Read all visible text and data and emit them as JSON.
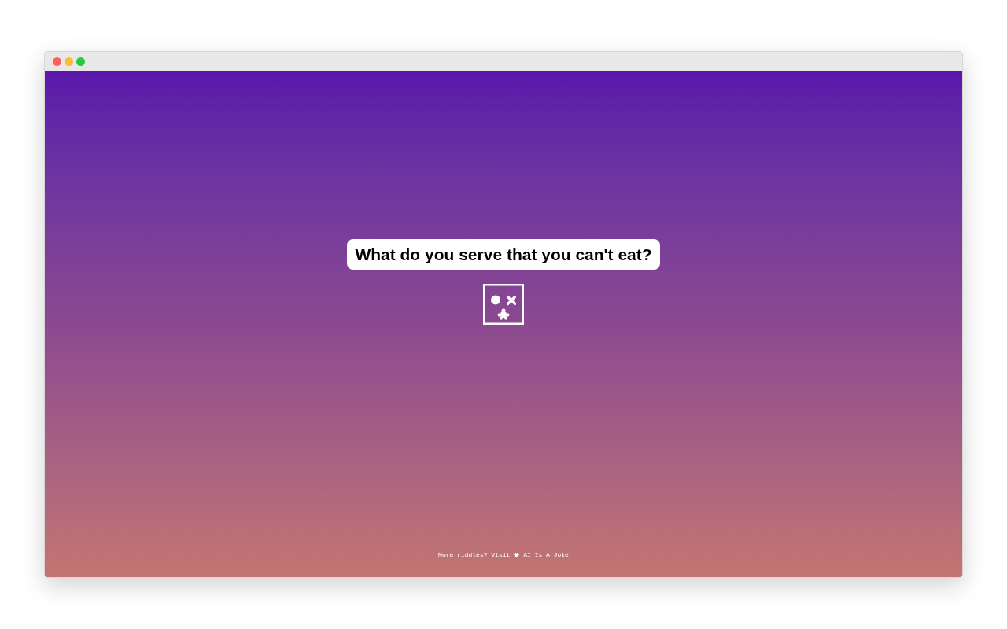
{
  "window": {
    "controls": [
      {
        "color": "#ff5f57"
      },
      {
        "color": "#febc2e"
      },
      {
        "color": "#28c840"
      }
    ]
  },
  "riddle": {
    "question": "What do you serve that you can't eat?"
  },
  "footer": {
    "text": "More riddles? Visit",
    "link": "AI Is A Joke"
  }
}
